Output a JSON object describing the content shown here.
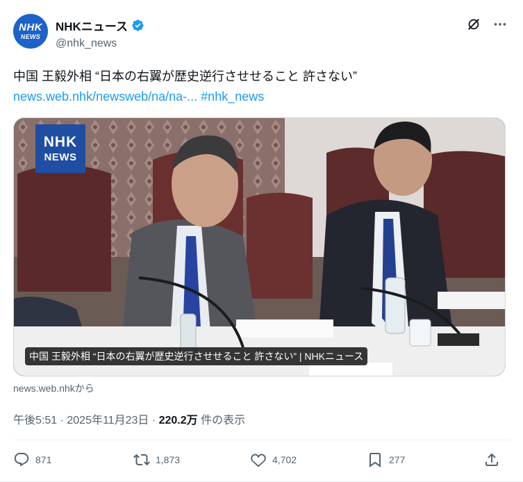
{
  "author": {
    "avatar_line1": "NHK",
    "avatar_line2": "NEWS",
    "display_name": "NHKニュース",
    "handle": "@nhk_news"
  },
  "icons": {
    "verified": "verified-badge-icon",
    "grok": "grok-icon",
    "more": "more-icon",
    "reply": "reply-icon",
    "retweet": "retweet-icon",
    "like": "like-icon",
    "bookmark": "bookmark-icon",
    "share": "share-icon"
  },
  "tweet": {
    "text": "中国 王毅外相 “日本の右翼が歴史逆行させせること 許さない”",
    "link": "news.web.nhk/newsweb/na/na-...",
    "hashtag": "#nhk_news"
  },
  "card": {
    "logo_line1": "NHK",
    "logo_line2": "NEWS",
    "caption": "中国 王毅外相 “日本の右翼が歴史逆行させせること 許さない” | NHKニュース",
    "source": "news.web.nhkから"
  },
  "meta": {
    "time": "午後5:51",
    "sep1": " · ",
    "date": "2025年11月23日",
    "sep2": " · ",
    "views": "220.2万",
    "views_label": " 件の表示"
  },
  "actions": {
    "replies": "871",
    "retweets": "1,873",
    "likes": "4,702",
    "bookmarks": "277"
  },
  "colors": {
    "accent": "#1d9bf0",
    "verified": "#1d9bf0",
    "nhk_blue": "#1f4ea3",
    "muted_text": "#536471"
  }
}
